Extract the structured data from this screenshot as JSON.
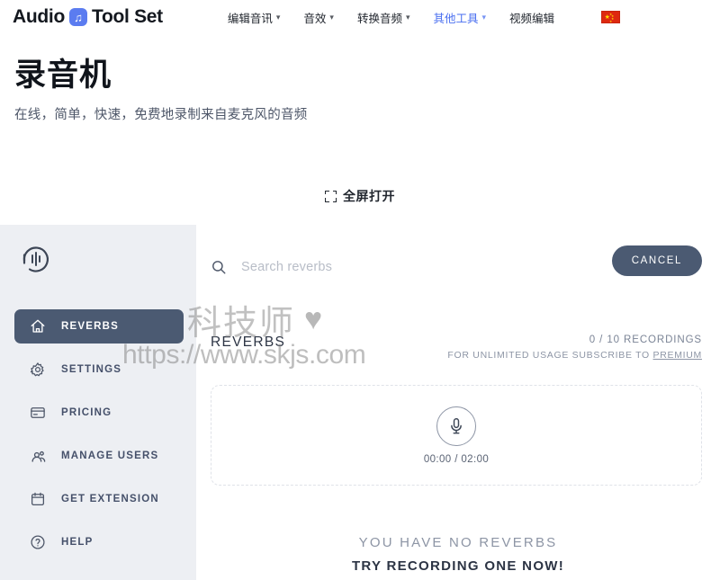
{
  "topnav": {
    "brand_left": "Audio",
    "brand_badge_icon": "music-note-icon",
    "brand_right": "Tool Set",
    "items": [
      {
        "label": "编辑音讯",
        "has_caret": true,
        "accent": false
      },
      {
        "label": "音效",
        "has_caret": true,
        "accent": false
      },
      {
        "label": "转换音频",
        "has_caret": true,
        "accent": false
      },
      {
        "label": "其他工具",
        "has_caret": true,
        "accent": true
      },
      {
        "label": "视频编辑",
        "has_caret": false,
        "accent": false
      }
    ],
    "caret_glyph": "⌄",
    "flag": "china-flag-icon"
  },
  "header": {
    "title": "录音机",
    "subtitle": "在线，简单，快速，免费地录制来自麦克风的音频"
  },
  "fullscreen": {
    "label": "全屏打开",
    "icon": "fullscreen-expand-icon"
  },
  "sidebar": {
    "logo": "audio-waveform-headphone-logo",
    "items": [
      {
        "label": "REVERBS",
        "icon": "home-icon",
        "active": true
      },
      {
        "label": "SETTINGS",
        "icon": "gear-icon",
        "active": false
      },
      {
        "label": "PRICING",
        "icon": "card-icon",
        "active": false
      },
      {
        "label": "MANAGE USERS",
        "icon": "users-icon",
        "active": false
      },
      {
        "label": "GET EXTENSION",
        "icon": "calendar-icon",
        "active": false
      },
      {
        "label": "HELP",
        "icon": "question-icon",
        "active": false
      }
    ]
  },
  "main": {
    "search": {
      "placeholder": "Search reverbs",
      "value": "",
      "icon": "search-icon"
    },
    "cancel_label": "CANCEL",
    "section_title": "REVERBS",
    "quota_count": "0 / 10 RECORDINGS",
    "quota_note_prefix": "FOR UNLIMITED USAGE SUBSCRIBE TO ",
    "quota_note_link": "PREMIUM",
    "recorder": {
      "icon": "microphone-icon",
      "timer": "00:00 / 02:00"
    },
    "empty_line1": "YOU HAVE NO REVERBS",
    "empty_line2": "TRY RECORDING ONE NOW!"
  },
  "watermark": {
    "text": "科技师",
    "heart": "♥",
    "url": "https://www.skjs.com"
  },
  "colors": {
    "accent_blue": "#4a6ff0",
    "brand_badge": "#5b7cf0",
    "sidebar_bg": "#edeff3",
    "active_item": "#4b5a72",
    "muted_text": "#8d95a5",
    "flag_red": "#de2910"
  }
}
